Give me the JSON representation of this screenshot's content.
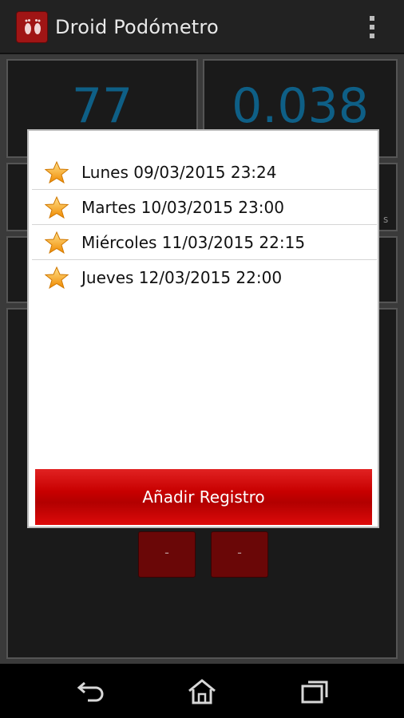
{
  "app": {
    "title": "Droid Podómetro",
    "icon": "footprints-icon"
  },
  "stats": {
    "steps": "77",
    "distance": "0.038",
    "side_suffix": "s"
  },
  "buttons": {
    "minus_left": "-",
    "minus_right": "-"
  },
  "dialog": {
    "items": [
      {
        "icon": "star-icon",
        "label": "Lunes 09/03/2015 23:24"
      },
      {
        "icon": "star-icon",
        "label": "Martes 10/03/2015 23:00"
      },
      {
        "icon": "star-icon",
        "label": "Miércoles 11/03/2015 22:15"
      },
      {
        "icon": "star-icon",
        "label": "Jueves 12/03/2015 22:00"
      }
    ],
    "add_button": "Añadir Registro"
  },
  "navbar": {
    "icons": [
      "back-icon",
      "home-icon",
      "recents-icon"
    ]
  },
  "colors": {
    "accent_red": "#c80000",
    "stat_blue": "#0e5f86",
    "star_gold": "#f5a623"
  }
}
